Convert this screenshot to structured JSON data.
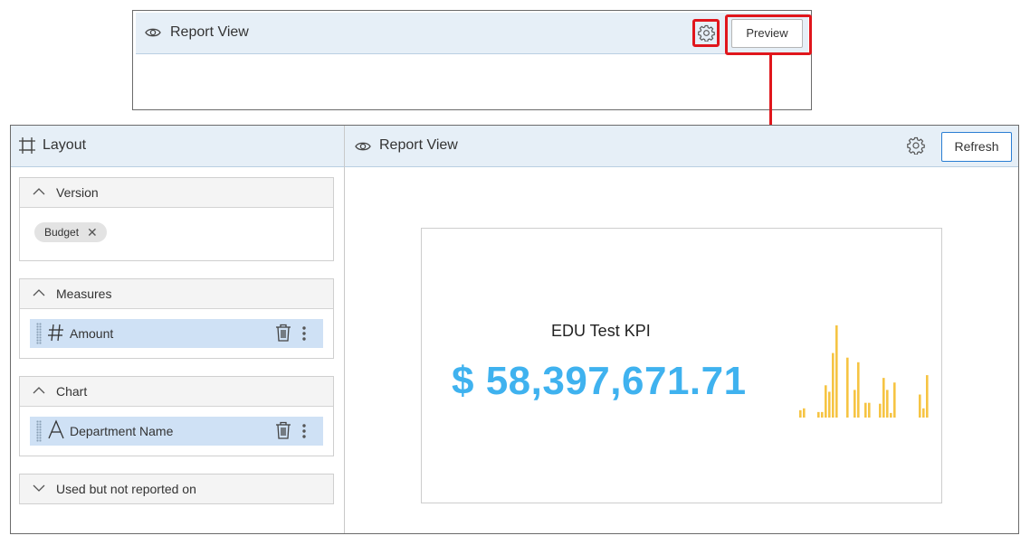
{
  "top_panel": {
    "title": "Report View",
    "preview_label": "Preview"
  },
  "layout_panel": {
    "title": "Layout",
    "sections": [
      {
        "label": "Version",
        "chips": [
          "Budget"
        ]
      },
      {
        "label": "Measures",
        "fields": [
          {
            "name": "Amount",
            "icon": "hash-icon"
          }
        ]
      },
      {
        "label": "Chart",
        "fields": [
          {
            "name": "Department Name",
            "icon": "text-type-icon"
          }
        ]
      },
      {
        "label": "Used but not reported on"
      }
    ]
  },
  "report_panel": {
    "title": "Report View",
    "refresh_label": "Refresh",
    "kpi": {
      "title": "EDU Test KPI",
      "value": "$ 58,397,671.71",
      "sparkline": [
        0.08,
        0.1,
        0,
        0,
        0,
        0.06,
        0.06,
        0.35,
        0.28,
        0.7,
        1,
        0,
        0,
        0.65,
        0,
        0.3,
        0.6,
        0,
        0.16,
        0.16,
        0,
        0,
        0.15,
        0.43,
        0.3,
        0.05,
        0.38,
        0,
        0,
        0,
        0,
        0,
        0,
        0.25,
        0.1,
        0.46
      ]
    }
  },
  "colors": {
    "accent": "#3fb2ef",
    "sparkline": "#f6c443",
    "highlight": "#e0161c",
    "header_bg": "#e6eff7"
  }
}
